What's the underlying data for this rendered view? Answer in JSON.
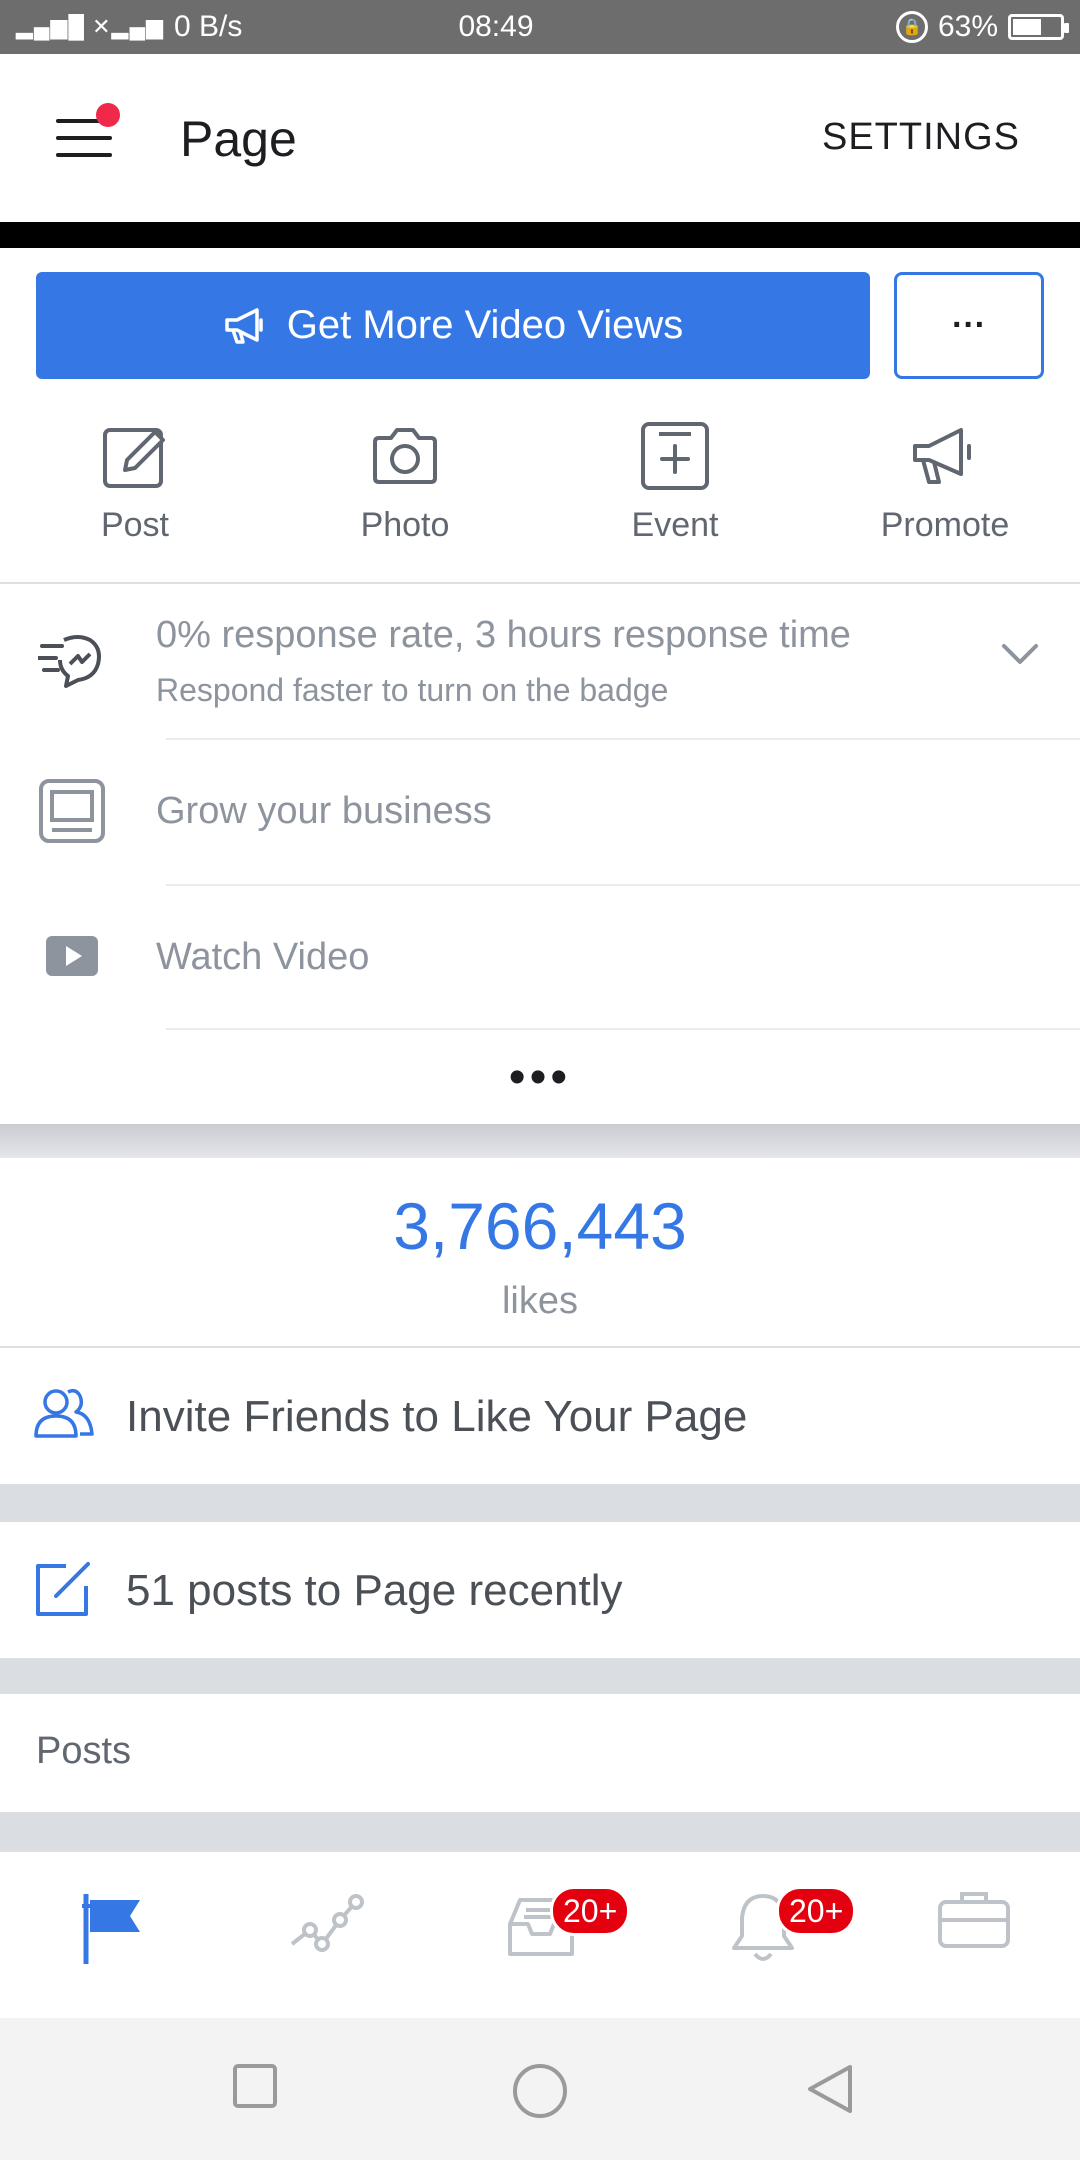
{
  "status_bar": {
    "network": "4G",
    "speed": "0 B/s",
    "time": "08:49",
    "battery": "63%",
    "battery_level": 0.63
  },
  "header": {
    "title": "Page",
    "settings_label": "SETTINGS"
  },
  "actions": {
    "cta_label": "Get More Video Views",
    "more_label": "···",
    "quick": [
      {
        "label": "Post",
        "icon": "edit-icon"
      },
      {
        "label": "Photo",
        "icon": "camera-icon"
      },
      {
        "label": "Event",
        "icon": "event-icon"
      },
      {
        "label": "Promote",
        "icon": "megaphone-icon"
      }
    ]
  },
  "info": {
    "response_title": "0% response rate, 3 hours response time",
    "response_sub": "Respond faster to turn on the badge",
    "grow_label": "Grow your business",
    "watch_label": "Watch Video",
    "more_dots": "•••"
  },
  "stats": {
    "likes_count": "3,766,443",
    "likes_label": "likes"
  },
  "rows": {
    "invite": "Invite Friends to Like Your Page",
    "recent_posts": "51 posts to Page recently",
    "posts_header": "Posts"
  },
  "tabs": {
    "inbox_badge": "20+",
    "notifications_badge": "20+"
  },
  "colors": {
    "accent": "#3578e5",
    "badge": "#e4000f",
    "muted": "#8d949e"
  }
}
